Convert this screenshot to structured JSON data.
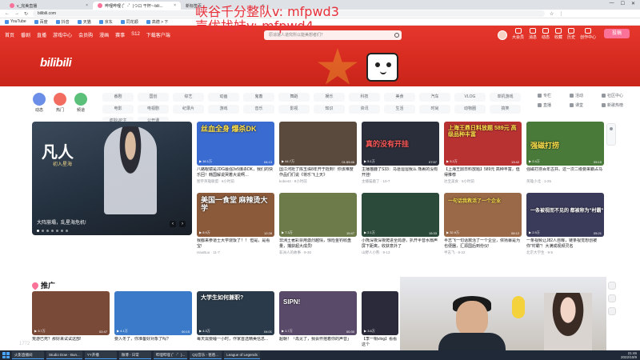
{
  "browser": {
    "tabs": [
      {
        "label": "v_完美直播",
        "active": false
      },
      {
        "label": "哔哩哔哩 (゜-゜)つロ 干杯~-bili...",
        "active": true
      },
      {
        "label": "新标签页",
        "active": false
      }
    ],
    "address": "bilibili.com",
    "bookmarks": [
      "YouTube",
      "百度",
      "抖音",
      "天猫",
      "京东",
      "同花顺",
      "高德 > 下"
    ]
  },
  "overlay": {
    "line1": "峡谷千分整队v: mfpwd3",
    "line2": "声优找妹v: mfpwd4"
  },
  "top_nav": [
    "首页",
    "番剧",
    "直播",
    "游戏中心",
    "会员购",
    "漫画",
    "赛事",
    "S12",
    "下载客户端"
  ],
  "search": {
    "placeholder": "原谅速人道究所以能美想者们？"
  },
  "tools": [
    "大会员",
    "消息",
    "动态",
    "收藏",
    "历史",
    "创作中心"
  ],
  "upload_label": "投稿",
  "logo": "bilibili",
  "quick_links": [
    {
      "label": "动态",
      "color": "#6b8ee8"
    },
    {
      "label": "热门",
      "color": "#f26c60"
    },
    {
      "label": "频道",
      "color": "#5bc17a"
    }
  ],
  "categories": [
    "番剧",
    "国创",
    "综艺",
    "动画",
    "鬼畜",
    "舞蹈",
    "娱乐",
    "科技",
    "美食",
    "汽车",
    "VLOG",
    "单机游戏",
    "电影",
    "电视剧",
    "纪录片",
    "游戏",
    "音乐",
    "影视",
    "知识",
    "资讯",
    "生活",
    "时尚",
    "动物圈",
    "搞笑",
    "虚拟UP主",
    "公开课"
  ],
  "side_links": [
    "专栏",
    "活动",
    "社区中心",
    "直播",
    "课堂",
    "新歌热榜"
  ],
  "carousel": {
    "title": "凡人",
    "subtitle": "初入星海",
    "caption": "大阵崩塌，乱星海危机!"
  },
  "cards": [
    {
      "overlay": "丝血全身 爆杀DK",
      "title": "八路眼镜是JDG最强3v5爆杀DK，我们的快乐回！韩国解说哭着大说啊…",
      "meta": "图宇英雄联盟 · 6小时前",
      "stats": "▶ 16.1万",
      "dur": "04:13",
      "color": "#3a6bd1"
    },
    {
      "overlay": "",
      "title": "国江河抢了陈玉珠8年开于抵到！你该难度作品们们说《将乐飞上天》",
      "meta": "kobe44 · 9小时前",
      "stats": "▶ 44.7万",
      "dur": "01:59:46",
      "color": "#5a4a3d"
    },
    {
      "overlay": "真的没有开挂",
      "title": "主播猫鹿了S33：马道溜溜我么 熊裹的没有开挂!",
      "meta": "主播猫鹿了 · 10-7",
      "stats": "▶ 5.1万",
      "dur": "07:57",
      "color": "#2a2e3a"
    },
    {
      "overlay": "上海王鼎日料放题 589元 高级品种丰富",
      "title": "【上海王鼎日料放题】589元 高种丰富，值得推荐",
      "meta": "达宝美食 · 5小时前",
      "stats": "▶ 5.2万",
      "dur": "13:42",
      "color": "#b83232"
    },
    {
      "overlay": "强磁打捞",
      "title": "强磁打捞百年古井。这一次二级要来霸占马",
      "meta": "英雄小北 · 1-25",
      "stats": "▶ 2.4万",
      "dur": "09:15",
      "color": "#4a7a3a"
    },
    {
      "overlay": "美国一食堂 麻辣烫大学",
      "title": "我都来参道士大学烧饭了！！ 但是，是看宝!",
      "meta": "HaoBuu · 11-7",
      "stats": "▶ 8.9万",
      "dur": "12:28",
      "color": "#8a5a3a"
    },
    {
      "overlay": "",
      "title": "非洲土著彩票用激烈越情，惊险金钓收盘量，捕获超大成员!",
      "meta": "非洲人的故事 · 9-30",
      "stats": "▶ 7.3万",
      "dur": "10:47",
      "color": "#6d7b4a"
    },
    {
      "overlay": "",
      "title": "小熊深夜深夜爬进全局游，扒开半音水扇声屏下距离，收获意外了",
      "meta": "山野人小熊 · 9-13",
      "stats": "▶ 2.1万",
      "dur": "15:33",
      "color": "#2c4a3a"
    },
    {
      "overlay": "一句话我救活了一个企业",
      "title": "半志飞一句话救活了一个企业，依扬暴是为也便器，汇源国后到份仪!",
      "meta": "半志飞 · 8-22",
      "stats": "▶ 32.9万",
      "dur": "06:12",
      "color": "#9a6a48"
    },
    {
      "overlay": "一条被视而不见的 都被称为\"村霸\"",
      "title": "一条视频让J82人自曝，链条视觉想创被你\"村霸\"！大满成视频灵名",
      "meta": "北京大学生 · 9-5",
      "stats": "▶ 2.9万",
      "dur": "05:21",
      "color": "#3a3a5a"
    }
  ],
  "promo": {
    "heading": "推广",
    "cards": [
      {
        "title": "荒游已死？那好来试试这部!",
        "stats": "▶ 3.7万",
        "dur": "02:47",
        "color": "#7a4a38"
      },
      {
        "title": "要入冬了，你准备好对象了吗?",
        "stats": "▶ 4.1万",
        "dur": "00:15",
        "color": "#3a7ac8"
      },
      {
        "title": "每天需要睡一小时，作家首选精美信息...",
        "stats": "▶ 4.3万",
        "dur": "04:01",
        "color": "#2a3a4a",
        "overlay": "大学生如何兼职?"
      },
      {
        "title": "超朝！「再见了，我会怀抱着你的声音」",
        "stats": "▶ 1.7万",
        "dur": "00:30",
        "color": "#5a4a6a",
        "overlay": "SIPN!"
      },
      {
        "title": "【李一桐vlog】看看这个",
        "stats": "▶ 3.6万",
        "dur": "01:12",
        "color": "#2a2a3a"
      }
    ]
  },
  "watermark": "1772",
  "taskbar": {
    "items": [
      "火影直播间",
      "Studio Dow - Bun...",
      "YY开播",
      "微博 - 日常",
      "哔哩哔哩 (゜-゜)...",
      "QQ音乐 - 爸爸...",
      "League of Legends"
    ],
    "time": "21:46",
    "date": "2022/10/9"
  }
}
